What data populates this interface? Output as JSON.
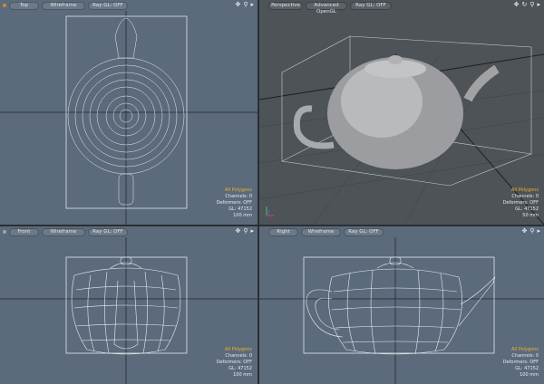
{
  "viewports": [
    {
      "view": "Top",
      "mode": "Wireframe",
      "ray": "Ray GL: OFF",
      "selection": "All Polygons",
      "channels": "Channels: 0",
      "deformers": "Deformers: OFF",
      "gl": "GL: 47152",
      "scale": "100 mm"
    },
    {
      "view": "Perspective",
      "mode": "Advanced OpenGL",
      "ray": "Ray GL: OFF",
      "selection": "All Polygons",
      "channels": "Channels: 0",
      "deformers": "Deformers: OFF",
      "gl": "GL: 47152",
      "scale": "50 mm"
    },
    {
      "view": "Front",
      "mode": "Wireframe",
      "ray": "Ray GL: OFF",
      "selection": "All Polygons",
      "channels": "Channels: 0",
      "deformers": "Deformers: OFF",
      "gl": "GL: 47152",
      "scale": "100 mm"
    },
    {
      "view": "Right",
      "mode": "Wireframe",
      "ray": "Ray GL: OFF",
      "selection": "All Polygons",
      "channels": "Channels: 0",
      "deformers": "Deformers: OFF",
      "gl": "GL: 47152",
      "scale": "100 mm"
    }
  ],
  "icons": [
    "move-icon",
    "rotate-icon",
    "zoom-icon",
    "menu-arrow-icon"
  ],
  "colors": {
    "ortho_bg": "#5b6b7b",
    "persp_bg": "#4e5358",
    "selection": "#f0b030"
  }
}
